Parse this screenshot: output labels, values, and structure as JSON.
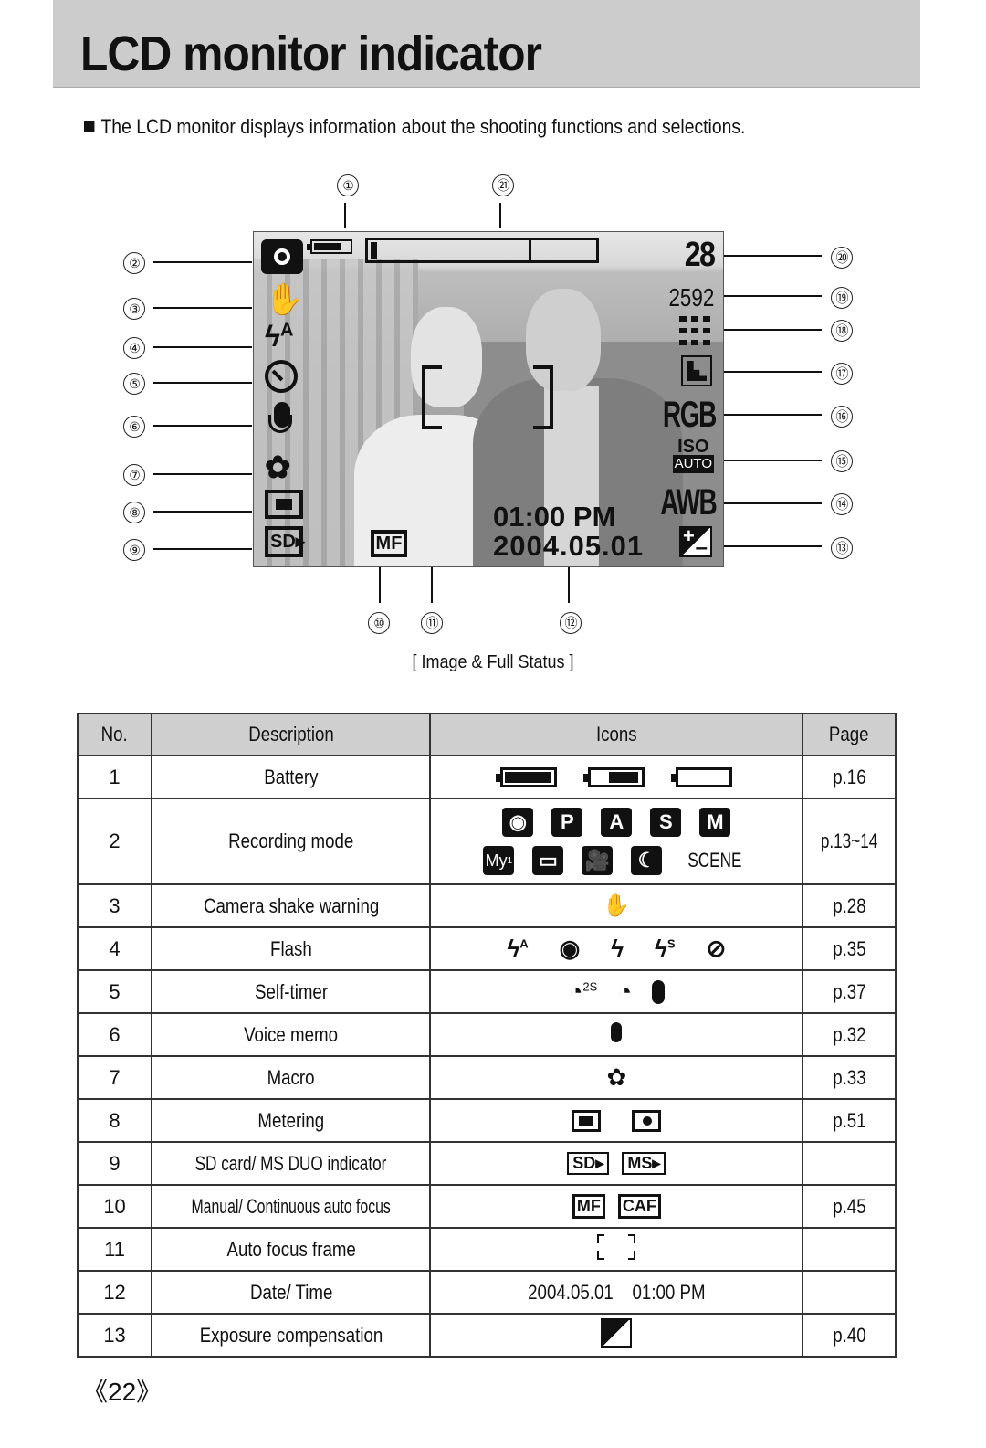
{
  "header": {
    "title": "LCD monitor indicator",
    "intro": "The LCD monitor displays information about the shooting functions and selections."
  },
  "diagram": {
    "caption": "[ Image & Full Status ]",
    "callouts": [
      "①",
      "②",
      "③",
      "④",
      "⑤",
      "⑥",
      "⑦",
      "⑧",
      "⑨",
      "⑩",
      "⑪",
      "⑫",
      "⑬",
      "⑭",
      "⑮",
      "⑯",
      "⑰",
      "⑱",
      "⑲",
      "⑳",
      "㉑"
    ],
    "lcd": {
      "shots_remaining": "28",
      "resolution": "2592",
      "color_mode": "RGB",
      "iso_label": "ISO",
      "iso_value": "AUTO",
      "white_balance": "AWB",
      "flash_mode_suffix": "A",
      "focus_mode": "MF",
      "card": "SD",
      "time": "01:00 PM",
      "date": "2004.05.01",
      "battery_level": 0.75
    }
  },
  "table": {
    "headers": [
      "No.",
      "Description",
      "Icons",
      "Page"
    ],
    "rows": [
      {
        "no": "1",
        "desc": "Battery",
        "page": "p.16"
      },
      {
        "no": "2",
        "desc": "Recording mode",
        "page": "p.13~14",
        "icons_text": [
          "P",
          "A",
          "S",
          "M",
          "My",
          "1",
          "SCENE"
        ]
      },
      {
        "no": "3",
        "desc": "Camera shake warning",
        "page": "p.28"
      },
      {
        "no": "4",
        "desc": "Flash",
        "page": "p.35",
        "icons_text": [
          "A",
          "S"
        ]
      },
      {
        "no": "5",
        "desc": "Self-timer",
        "page": "p.37",
        "icons_text": [
          "2S"
        ]
      },
      {
        "no": "6",
        "desc": "Voice memo",
        "page": "p.32"
      },
      {
        "no": "7",
        "desc": "Macro",
        "page": "p.33"
      },
      {
        "no": "8",
        "desc": "Metering",
        "page": "p.51"
      },
      {
        "no": "9",
        "desc": "SD card/ MS DUO indicator",
        "page": "",
        "icons_text": [
          "SD",
          "MS"
        ]
      },
      {
        "no": "10",
        "desc": "Manual/ Continuous auto focus",
        "page": "p.45",
        "icons_text": [
          "MF",
          "CAF"
        ]
      },
      {
        "no": "11",
        "desc": "Auto focus frame",
        "page": ""
      },
      {
        "no": "12",
        "desc": "Date/ Time",
        "page": "",
        "icons_text": [
          "2004.05.01",
          "01:00 PM"
        ]
      },
      {
        "no": "13",
        "desc": "Exposure compensation",
        "page": "p.40"
      }
    ]
  },
  "footer": {
    "page_number": "《22》"
  }
}
